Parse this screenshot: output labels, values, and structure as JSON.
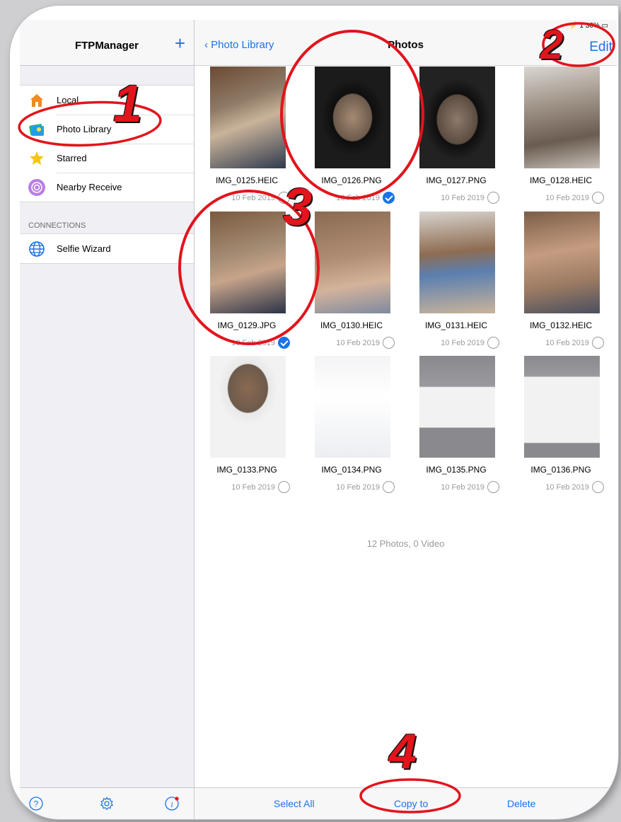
{
  "status_bar": {
    "text": "⚡ 1 30% ▭"
  },
  "sidebar": {
    "title": "FTPManager",
    "add_icon": "+",
    "items": [
      {
        "label": "Local",
        "icon": "house-icon"
      },
      {
        "label": "Photo Library",
        "icon": "photos-icon"
      },
      {
        "label": "Starred",
        "icon": "star-icon"
      },
      {
        "label": "Nearby Receive",
        "icon": "airdrop-icon"
      }
    ],
    "section_header": "CONNECTIONS",
    "connections": [
      {
        "label": "Selfie Wizard",
        "icon": "globe-icon"
      }
    ],
    "bottom_icons": [
      "help-icon",
      "settings-icon",
      "info-icon"
    ]
  },
  "header": {
    "back_label": "Photo Library",
    "title": "Photos",
    "edit_label": "Edit"
  },
  "photos": [
    {
      "name": "IMG_0125.HEIC",
      "date": "10 Feb 2019",
      "selected": false
    },
    {
      "name": "IMG_0126.PNG",
      "date": "10 Feb 2019",
      "selected": true
    },
    {
      "name": "IMG_0127.PNG",
      "date": "10 Feb 2019",
      "selected": false
    },
    {
      "name": "IMG_0128.HEIC",
      "date": "10 Feb 2019",
      "selected": false
    },
    {
      "name": "IMG_0129.JPG",
      "date": "10 Feb 2019",
      "selected": true
    },
    {
      "name": "IMG_0130.HEIC",
      "date": "10 Feb 2019",
      "selected": false
    },
    {
      "name": "IMG_0131.HEIC",
      "date": "10 Feb 2019",
      "selected": false
    },
    {
      "name": "IMG_0132.HEIC",
      "date": "10 Feb 2019",
      "selected": false
    },
    {
      "name": "IMG_0133.PNG",
      "date": "10 Feb 2019",
      "selected": false
    },
    {
      "name": "IMG_0134.PNG",
      "date": "10 Feb 2019",
      "selected": false
    },
    {
      "name": "IMG_0135.PNG",
      "date": "10 Feb 2019",
      "selected": false
    },
    {
      "name": "IMG_0136.PNG",
      "date": "10 Feb 2019",
      "selected": false
    }
  ],
  "summary": "12 Photos, 0 Video",
  "toolbar": {
    "select_all": "Select All",
    "copy_to": "Copy to",
    "delete": "Delete"
  },
  "annotations": {
    "color": "#e2141c",
    "numbers": [
      "1",
      "2",
      "3",
      "4"
    ]
  },
  "colors": {
    "accent": "#1a73e8",
    "annotation": "#e2141c"
  }
}
